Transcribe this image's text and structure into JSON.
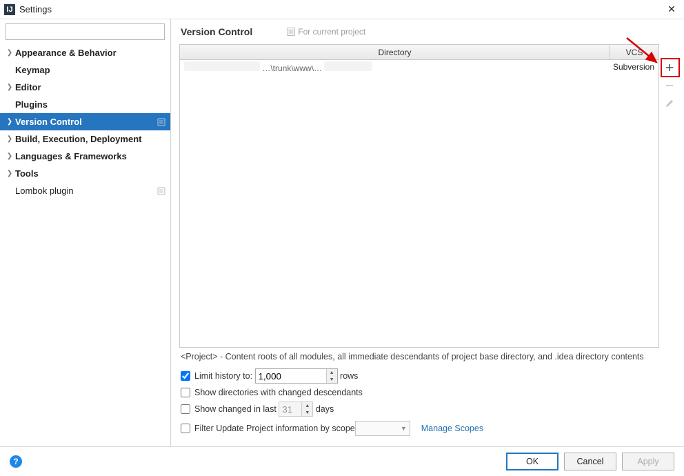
{
  "window": {
    "title": "Settings"
  },
  "search": {
    "placeholder": ""
  },
  "sidebar": {
    "items": [
      {
        "label": "Appearance & Behavior",
        "expandable": true
      },
      {
        "label": "Keymap",
        "expandable": false
      },
      {
        "label": "Editor",
        "expandable": true
      },
      {
        "label": "Plugins",
        "expandable": false
      },
      {
        "label": "Version Control",
        "expandable": true,
        "selected": true,
        "project": true
      },
      {
        "label": "Build, Execution, Deployment",
        "expandable": true
      },
      {
        "label": "Languages & Frameworks",
        "expandable": true
      },
      {
        "label": "Tools",
        "expandable": true
      },
      {
        "label": "Lombok plugin",
        "expandable": false,
        "project": true
      }
    ]
  },
  "header": {
    "breadcrumb": "Version Control",
    "for_project": "For current project"
  },
  "table": {
    "columns": {
      "directory": "Directory",
      "vcs": "VCS"
    },
    "rows": [
      {
        "directory": "…\\trunk\\www\\…",
        "vcs": "Subversion"
      }
    ]
  },
  "hint": "<Project> - Content roots of all modules, all immediate descendants of project base directory, and .idea directory contents",
  "options": {
    "limit_history_label_pre": "Limit history to:",
    "limit_history_value": "1,000",
    "limit_history_label_post": "rows",
    "limit_history_checked": true,
    "show_dirs": "Show directories with changed descendants",
    "show_dirs_checked": false,
    "show_changed_pre": "Show changed in last",
    "show_changed_value": "31",
    "show_changed_post": "days",
    "show_changed_checked": false,
    "filter_scope": "Filter Update Project information by scope",
    "filter_scope_checked": false,
    "manage_scopes": "Manage Scopes"
  },
  "buttons": {
    "ok": "OK",
    "cancel": "Cancel",
    "apply": "Apply"
  }
}
